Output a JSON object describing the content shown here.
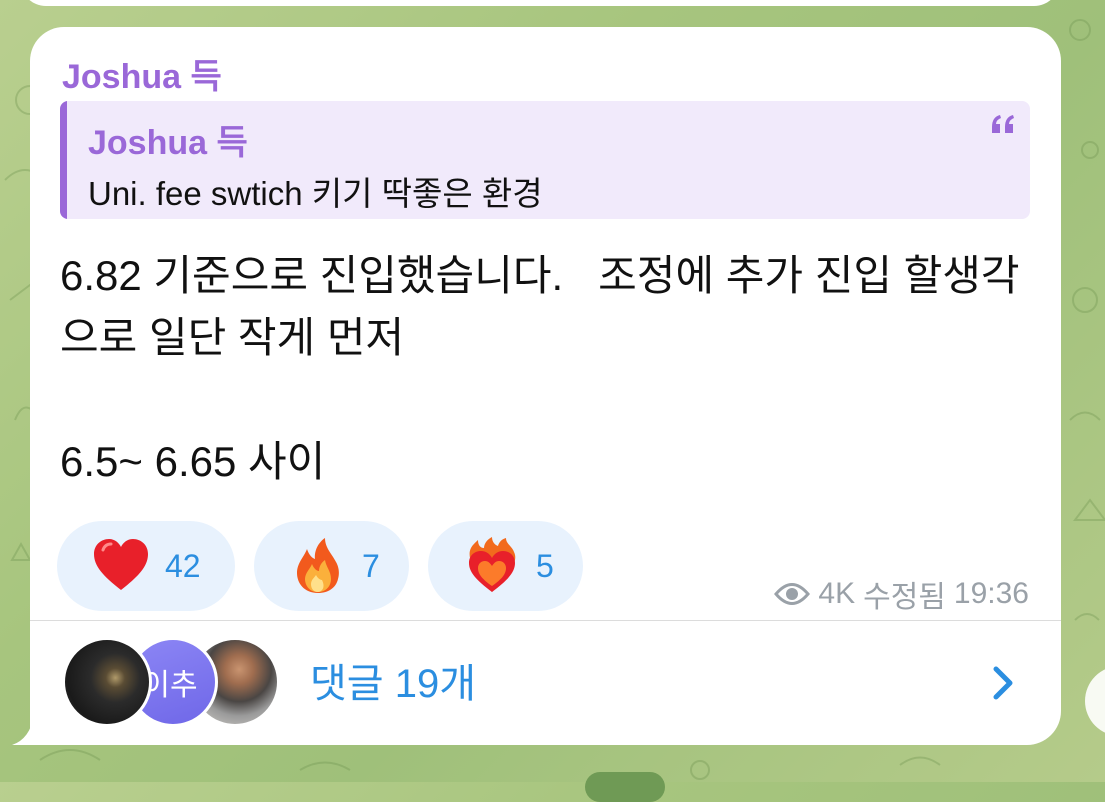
{
  "message": {
    "sender": "Joshua 득",
    "reply": {
      "sender": "Joshua 득",
      "text": "Uni.  fee swtich 키기 딱좋은 환경"
    },
    "text": "6.82 기준으로 진입했습니다.   조정에 추가 진입 할생각으로 일단 작게 먼저\n\n6.5~ 6.65 사이",
    "reactions": [
      {
        "emoji": "red-heart",
        "count": "42"
      },
      {
        "emoji": "fire",
        "count": "7"
      },
      {
        "emoji": "heart-on-fire",
        "count": "5"
      }
    ],
    "views": "4K",
    "edited_label": "수정됨",
    "time": "19:36",
    "comments": {
      "avatar_initial": "이추",
      "label": "댓글 19개"
    }
  },
  "colors": {
    "sender_name": "#9a68d8",
    "reply_background": "#f1eafb",
    "link_blue": "#2b8ee0",
    "reaction_background": "#e8f2fd",
    "meta_gray": "#9aa1a8"
  }
}
